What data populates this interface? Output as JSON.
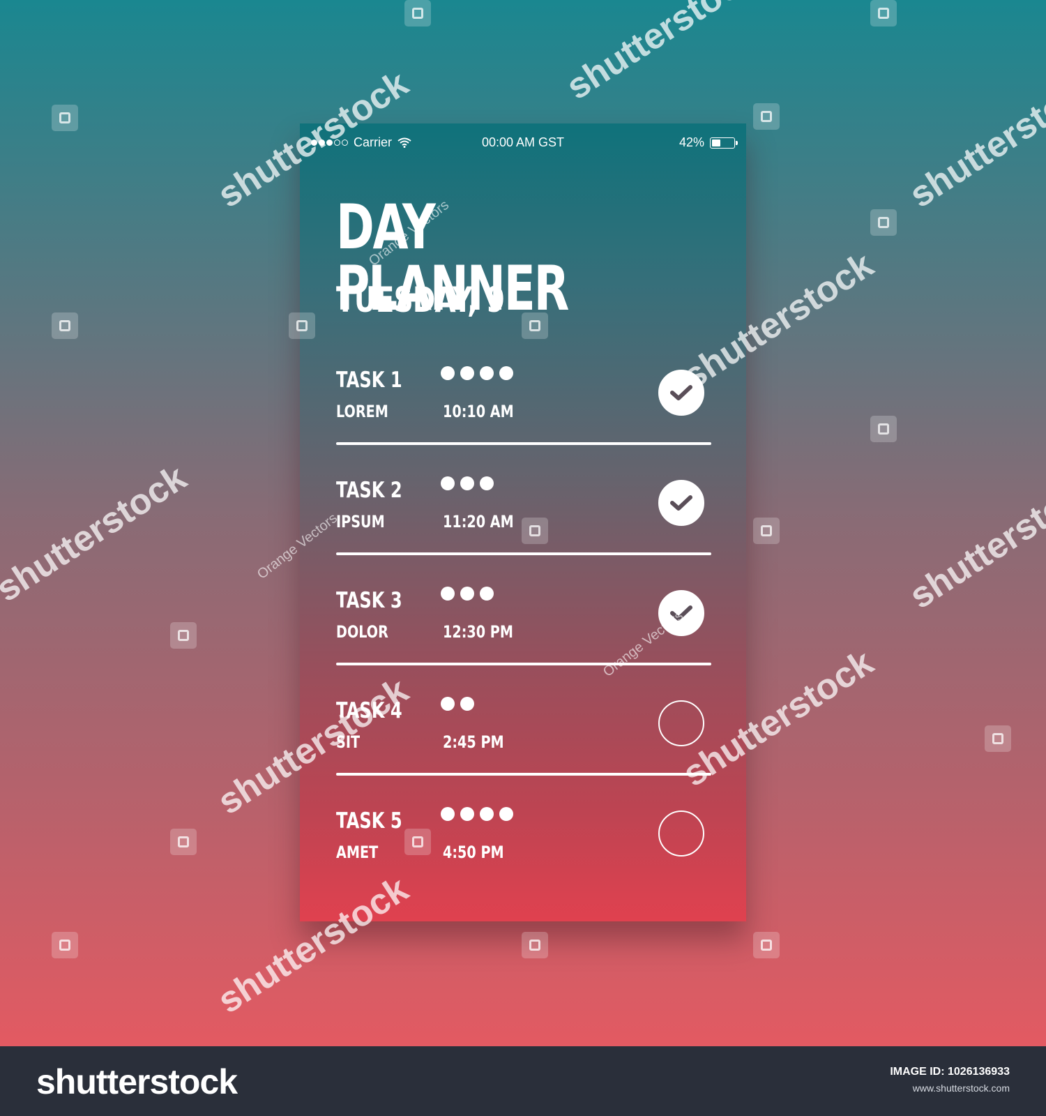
{
  "status_bar": {
    "carrier": "Carrier",
    "time": "00:00 AM GST",
    "battery": "42%",
    "battery_level": 0.42,
    "signal_bars_filled": 3,
    "signal_bars_total": 5
  },
  "header": {
    "title": "DAY PLANNER",
    "date": "TUESDAY, 9"
  },
  "tasks": [
    {
      "name": "TASK 1",
      "subtitle": "LOREM",
      "time": "10:10 AM",
      "priority": 4,
      "done": true
    },
    {
      "name": "TASK 2",
      "subtitle": "IPSUM",
      "time": "11:20 AM",
      "priority": 3,
      "done": true
    },
    {
      "name": "TASK 3",
      "subtitle": "DOLOR",
      "time": "12:30 PM",
      "priority": 3,
      "done": true
    },
    {
      "name": "TASK 4",
      "subtitle": "SIT",
      "time": "2:45 PM",
      "priority": 2,
      "done": false
    },
    {
      "name": "TASK 5",
      "subtitle": "AMET",
      "time": "4:50 PM",
      "priority": 4,
      "done": false
    }
  ],
  "watermark": {
    "text": "shutterstock",
    "contributor": "Orange Vectors"
  },
  "footer": {
    "brand": "shutterstock",
    "image_id": "IMAGE ID: 1026136933",
    "url": "www.shutterstock.com"
  },
  "colors": {
    "bg_top": "#1a8790",
    "bg_bottom": "#e35a62",
    "phone_top": "#0f727b",
    "phone_bottom": "#e0414f",
    "footer": "#2a2f3a",
    "check_mark": "#5a4e58"
  }
}
